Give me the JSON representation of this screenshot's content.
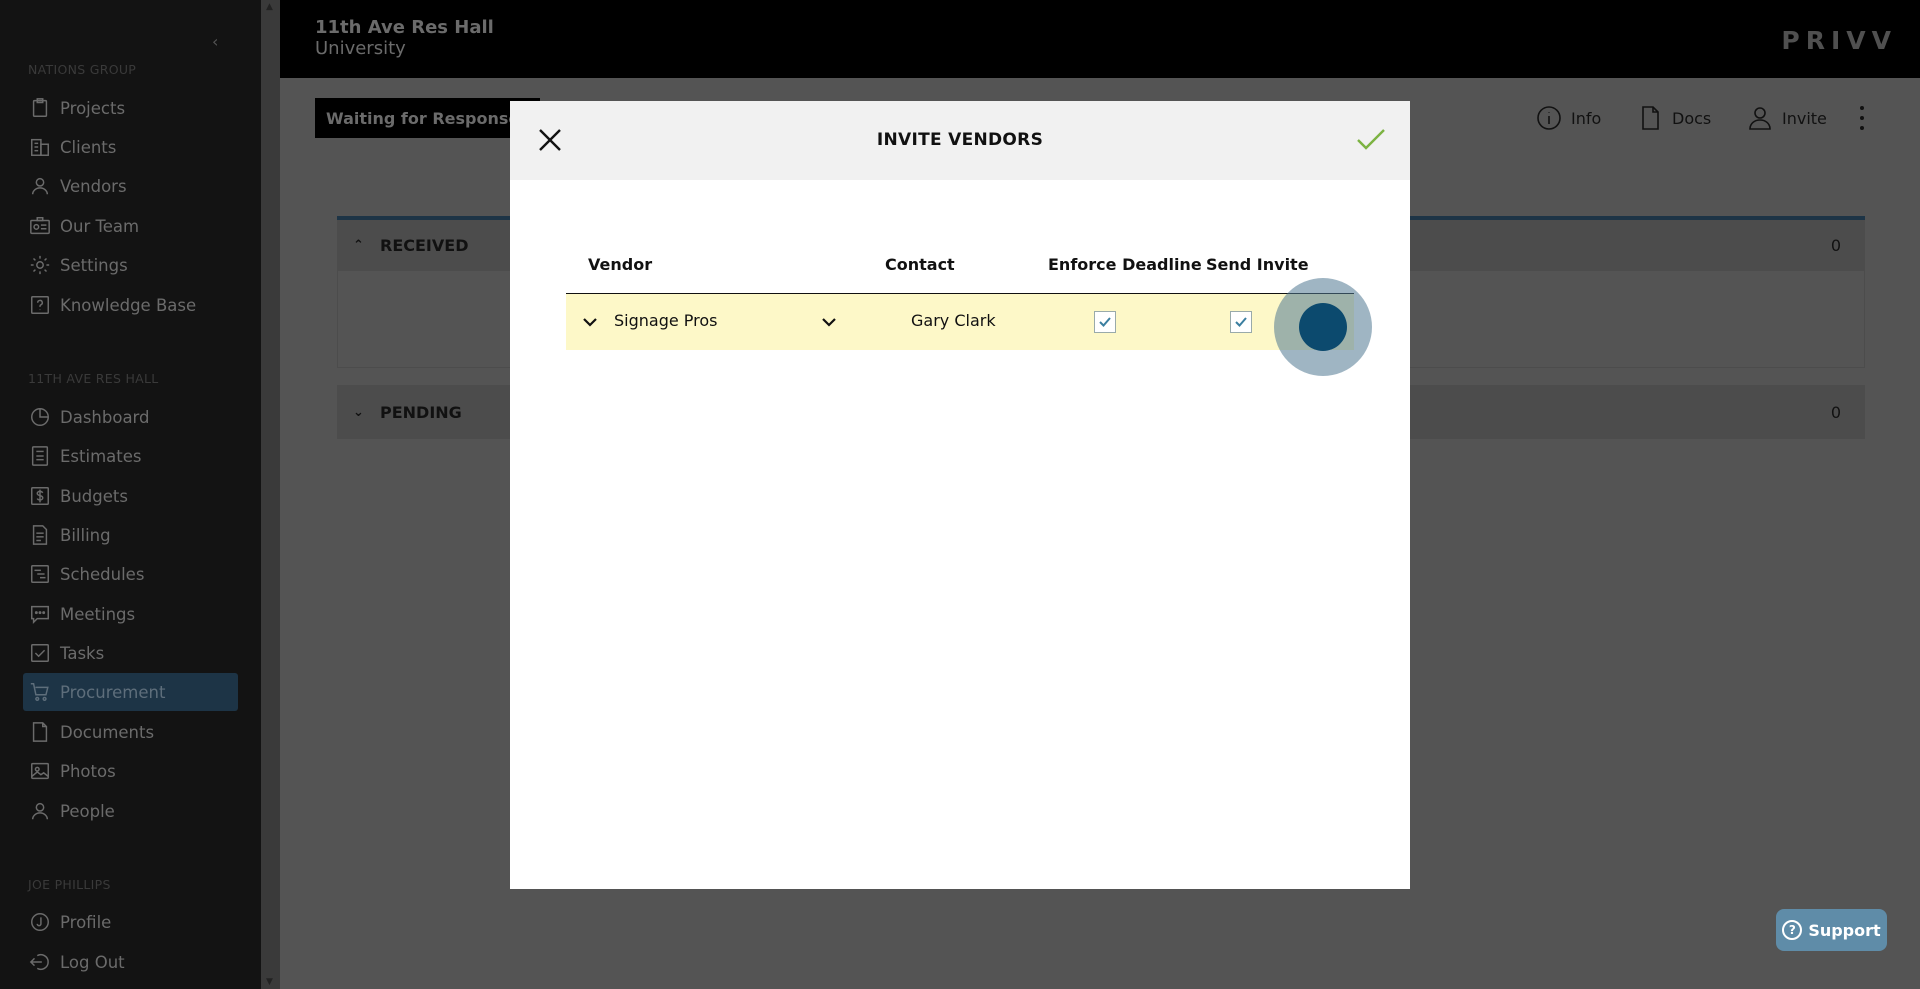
{
  "sidebar": {
    "org_section": "NATIONS GROUP",
    "org_items": [
      {
        "label": "Projects",
        "icon": "clipboard-icon"
      },
      {
        "label": "Clients",
        "icon": "building-icon"
      },
      {
        "label": "Vendors",
        "icon": "person-icon"
      },
      {
        "label": "Our Team",
        "icon": "id-card-icon"
      },
      {
        "label": "Settings",
        "icon": "gear-icon"
      },
      {
        "label": "Knowledge Base",
        "icon": "question-icon"
      }
    ],
    "project_section": "11TH AVE RES HALL",
    "project_items": [
      {
        "label": "Dashboard",
        "icon": "pie-icon"
      },
      {
        "label": "Estimates",
        "icon": "calculator-icon"
      },
      {
        "label": "Budgets",
        "icon": "dollar-icon"
      },
      {
        "label": "Billing",
        "icon": "invoice-icon"
      },
      {
        "label": "Schedules",
        "icon": "gantt-icon"
      },
      {
        "label": "Meetings",
        "icon": "chat-icon"
      },
      {
        "label": "Tasks",
        "icon": "checkbox-icon"
      },
      {
        "label": "Procurement",
        "icon": "cart-icon"
      },
      {
        "label": "Documents",
        "icon": "document-icon"
      },
      {
        "label": "Photos",
        "icon": "image-icon"
      },
      {
        "label": "People",
        "icon": "person-icon"
      }
    ],
    "active_item": "Procurement",
    "user_section": "JOE PHILLIPS",
    "user_items": [
      {
        "label": "Profile",
        "icon": "profile-icon"
      },
      {
        "label": "Log Out",
        "icon": "logout-icon"
      }
    ]
  },
  "header": {
    "project_name": "11th Ave Res Hall",
    "client_name": "University",
    "logo": "PRIVV"
  },
  "status": "Waiting for Responses",
  "actions": {
    "info": "Info",
    "docs": "Docs",
    "invite": "Invite"
  },
  "panels": {
    "received": {
      "label": "RECEIVED",
      "count": "0"
    },
    "pending": {
      "label": "PENDING",
      "count": "0"
    }
  },
  "modal": {
    "title": "INVITE VENDORS",
    "columns": {
      "vendor": "Vendor",
      "contact": "Contact",
      "enforce_deadline": "Enforce Deadline",
      "send_invite": "Send Invite"
    },
    "rows": [
      {
        "vendor": "Signage Pros",
        "contact": "Gary Clark",
        "enforce_deadline": true,
        "send_invite": true
      }
    ]
  },
  "support": "Support",
  "colors": {
    "accent": "#1d3446",
    "confirm": "#7cb342",
    "row_highlight": "#fdf8c8",
    "support": "#5f8ca8"
  }
}
